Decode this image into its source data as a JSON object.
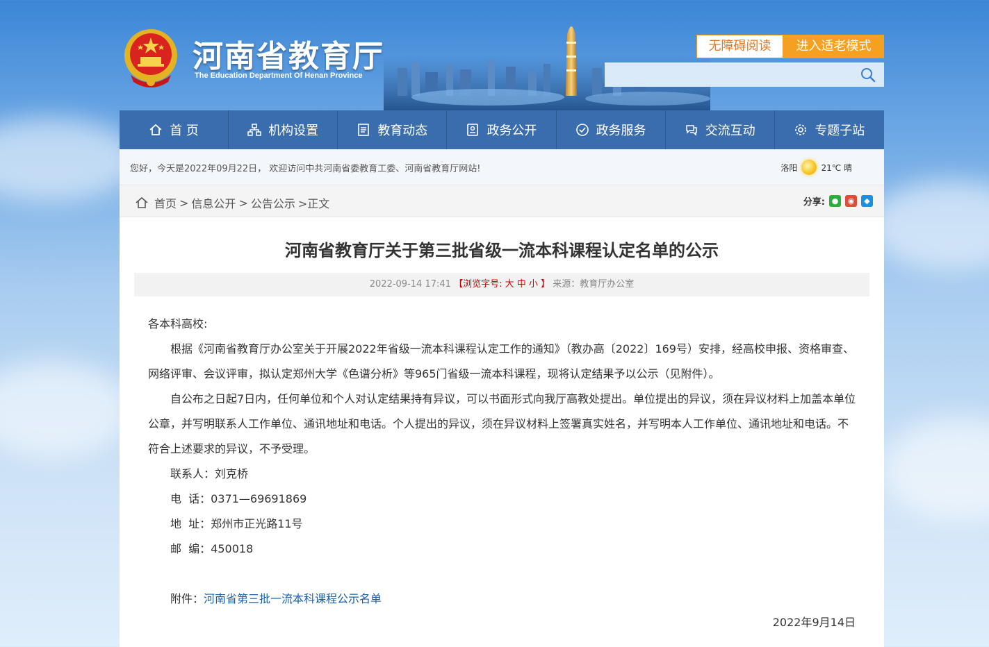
{
  "header": {
    "title": "河南省教育厅",
    "subtitle": "The Education Department Of Henan Province",
    "accessible_btn": "无障碍阅读",
    "elder_btn": "进入适老模式",
    "search_placeholder": ""
  },
  "nav": [
    {
      "label": "首 页",
      "icon": "home-icon"
    },
    {
      "label": "机构设置",
      "icon": "org-icon"
    },
    {
      "label": "教育动态",
      "icon": "news-icon"
    },
    {
      "label": "政务公开",
      "icon": "info-icon"
    },
    {
      "label": "政务服务",
      "icon": "service-icon"
    },
    {
      "label": "交流互动",
      "icon": "interact-icon"
    },
    {
      "label": "专题子站",
      "icon": "gear-icon"
    }
  ],
  "infobar": {
    "welcome": "您好，今天是2022年09月22日， 欢迎访问中共河南省委教育工委、河南省教育厅网站!",
    "city": "洛阳",
    "weather": "21℃ 晴"
  },
  "breadcrumb": {
    "home": "首页",
    "sep1": ">",
    "item1": "信息公开",
    "sep2": ">",
    "item2": "公告公示",
    "current": ">正文"
  },
  "share": {
    "label": "分享:"
  },
  "article": {
    "title": "河南省教育厅关于第三批省级一流本科课程认定名单的公示",
    "date": "2022-09-14 17:41",
    "font_label": "【浏览字号:",
    "font_large": "大",
    "font_medium": "中",
    "font_small": "小",
    "font_close": "】",
    "source": "来源：教育厅办公室",
    "salutation": "各本科高校:",
    "para1": "根据《河南省教育厅办公室关于开展2022年省级一流本科课程认定工作的通知》（教办高〔2022〕169号）安排，经高校申报、资格审查、网络评审、会议评审，拟认定郑州大学《色谱分析》等965门省级一流本科课程，现将认定结果予以公示（见附件）。",
    "para2": "自公布之日起7日内，任何单位和个人对认定结果持有异议，可以书面形式向我厅高教处提出。单位提出的异议，须在异议材料上加盖本单位公章，并写明联系人工作单位、通讯地址和电话。个人提出的异议，须在异议材料上签署真实姓名，并写明本人工作单位、通讯地址和电话。不符合上述要求的异议，不予受理。",
    "contact": "联系人：刘克桥",
    "phone": "电  话：0371—69691869",
    "address": "地  址：郑州市正光路11号",
    "postcode": "邮  编：450018",
    "attach_label": "附件：",
    "attach_link": "河南省第三批一流本科课程公示名单",
    "sign_date": "2022年9月14日"
  }
}
